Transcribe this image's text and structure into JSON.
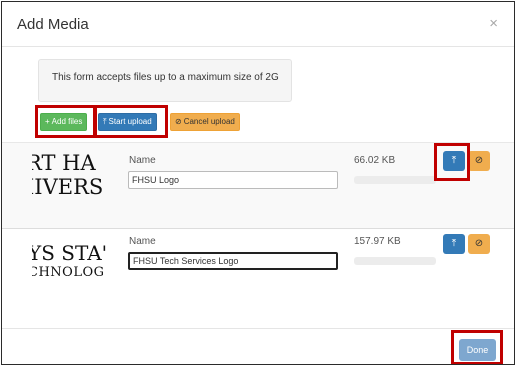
{
  "modal": {
    "title": "Add Media",
    "close_glyph": "×"
  },
  "info": {
    "text": "This form accepts files up to a maximum size of 2G"
  },
  "toolbar": {
    "add_files": {
      "label": "Add files",
      "icon": "plus-icon",
      "glyph": "+"
    },
    "start_upload": {
      "label": "Start upload",
      "icon": "upload-icon",
      "glyph": "⤒"
    },
    "cancel_upload": {
      "label": "Cancel upload",
      "icon": "ban-icon",
      "glyph": "⊘"
    }
  },
  "files": [
    {
      "preview_lines": [
        "RT HA",
        "IIVERS"
      ],
      "name_label": "Name",
      "name_value": "FHSU Logo",
      "size": "66.02 KB",
      "progress": 0,
      "upload_glyph": "⤒",
      "cancel_glyph": "⊘"
    },
    {
      "preview_lines": [
        "YS STA'",
        "CHNOLOG"
      ],
      "name_label": "Name",
      "name_value": "FHSU Tech Services Logo",
      "size": "157.97 KB",
      "progress": 0,
      "upload_glyph": "⤒",
      "cancel_glyph": "⊘"
    }
  ],
  "footer": {
    "done_label": "Done"
  },
  "colors": {
    "success": "#5cb85c",
    "primary": "#337ab7",
    "warning": "#f0ad4e",
    "highlight": "#c00000",
    "done_disabled": "#7ea7cf"
  }
}
